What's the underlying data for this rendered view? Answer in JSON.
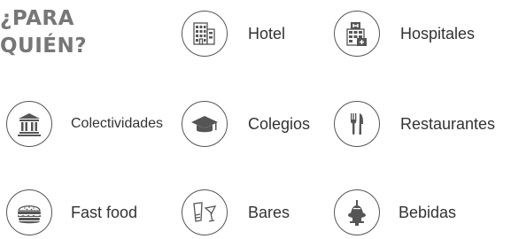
{
  "heading": {
    "line1": "¿PARA",
    "line2": "QUIÉN?"
  },
  "colors": {
    "heading": "#777777",
    "icon": "#555555",
    "text": "#333333"
  },
  "items": [
    {
      "label": "Hotel",
      "icon": "hotel-icon"
    },
    {
      "label": "Hospitales",
      "icon": "hospital-icon"
    },
    {
      "label": "Colectividades",
      "icon": "institution-icon"
    },
    {
      "label": "Colegios",
      "icon": "graduation-cap-icon"
    },
    {
      "label": "Restaurantes",
      "icon": "fork-knife-icon"
    },
    {
      "label": "Fast food",
      "icon": "burger-icon"
    },
    {
      "label": "Bares",
      "icon": "glasses-icon"
    },
    {
      "label": "Bebidas",
      "icon": "drink-dispenser-icon"
    }
  ]
}
